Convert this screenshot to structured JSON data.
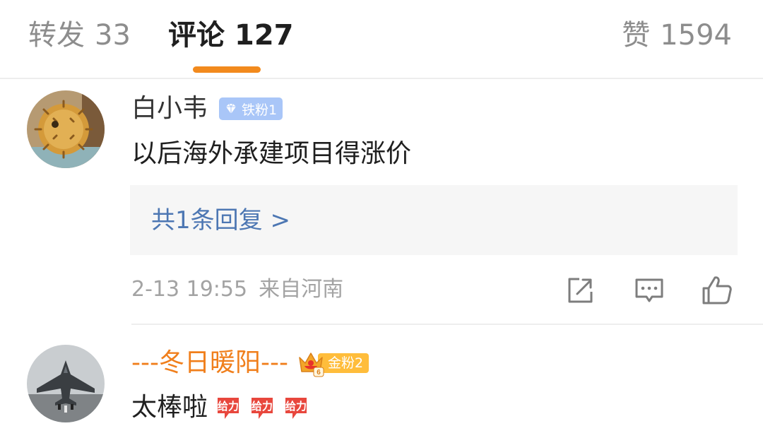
{
  "tabs": {
    "repost": {
      "label": "转发",
      "count": "33"
    },
    "comments": {
      "label": "评论",
      "count": "127"
    },
    "likes": {
      "label": "赞",
      "count": "1594"
    },
    "active_color": "#f28a1d"
  },
  "comments": [
    {
      "username": "白小韦",
      "badge": "铁粉1",
      "text": "以后海外承建项目得涨价",
      "replies_link": "共1条回复 >",
      "time": "2-13 19:55",
      "location": "来自河南",
      "actions": [
        "share-icon",
        "comment-icon",
        "like-icon"
      ]
    },
    {
      "username": "---冬日暖阳---",
      "badge": "金粉2",
      "crown_level": "6",
      "text": "太棒啦",
      "emoji": [
        "cheer-icon",
        "cheer-icon",
        "cheer-icon"
      ],
      "emoji_text": "给力"
    }
  ],
  "colors": {
    "link": "#4d77b3",
    "username_highlight": "#f07f1c",
    "badge_iron": "#a9c6f8",
    "badge_gold": "#ffbd3b",
    "muted": "#a3a3a3"
  }
}
